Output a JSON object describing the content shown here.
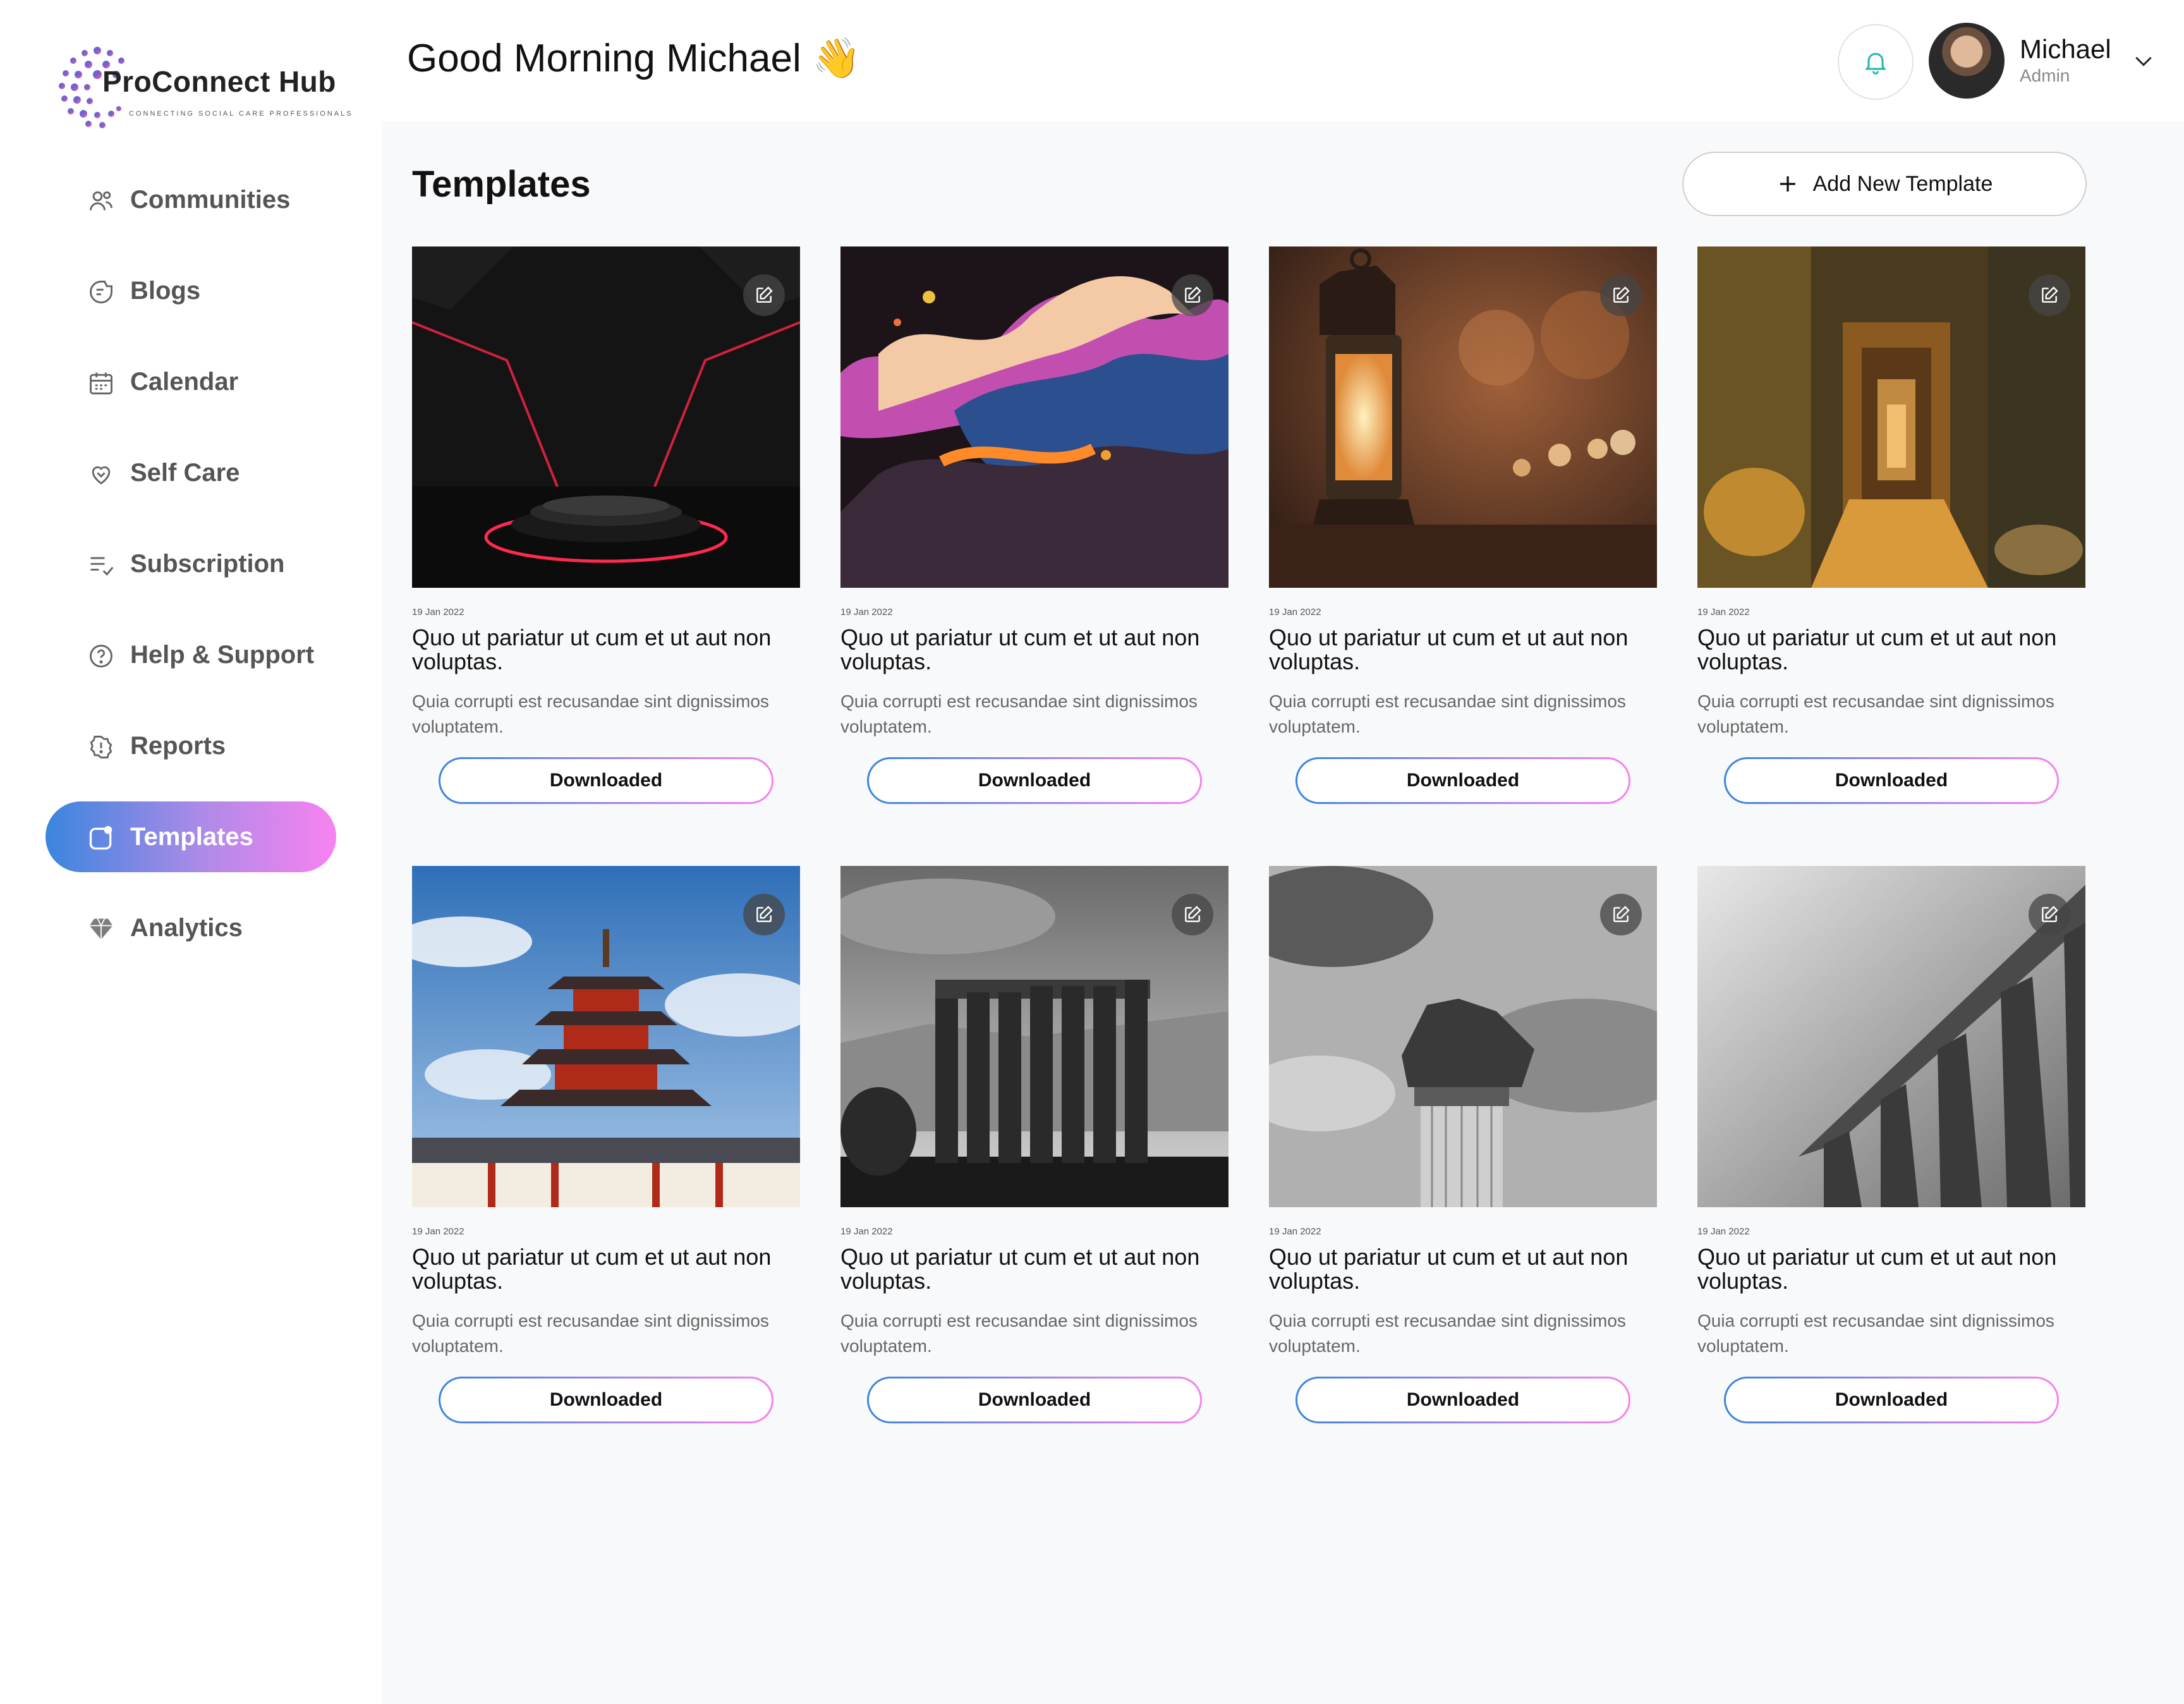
{
  "brand": {
    "name": "ProConnect Hub",
    "tagline": "CONNECTING SOCIAL CARE PROFESSIONALS"
  },
  "sidebar": {
    "items": [
      {
        "label": "Communities",
        "icon": "users-icon"
      },
      {
        "label": "Blogs",
        "icon": "blog-icon"
      },
      {
        "label": "Calendar",
        "icon": "calendar-icon"
      },
      {
        "label": "Self Care",
        "icon": "heart-icon"
      },
      {
        "label": "Subscription",
        "icon": "list-check-icon"
      },
      {
        "label": "Help & Support",
        "icon": "help-icon"
      },
      {
        "label": "Reports",
        "icon": "alert-icon"
      },
      {
        "label": "Templates",
        "icon": "template-icon",
        "active": true
      },
      {
        "label": "Analytics",
        "icon": "diamond-icon"
      }
    ]
  },
  "header": {
    "greeting": "Good Morning Michael",
    "wave_emoji": "👋",
    "user": {
      "name": "Michael",
      "role": "Admin"
    }
  },
  "main": {
    "title": "Templates",
    "add_button": "Add New Template",
    "cards": [
      {
        "date": "19 Jan 2022",
        "title": "Quo ut pariatur ut cum et ut aut non voluptas.",
        "desc": "Quia corrupti est recusandae sint dignissimos voluptatem.",
        "button": "Downloaded",
        "image": "stage-podium"
      },
      {
        "date": "19 Jan 2022",
        "title": "Quo ut pariatur ut cum et ut aut non voluptas.",
        "desc": "Quia corrupti est recusandae sint dignissimos voluptatem.",
        "button": "Downloaded",
        "image": "paint-splash"
      },
      {
        "date": "19 Jan 2022",
        "title": "Quo ut pariatur ut cum et ut aut non voluptas.",
        "desc": "Quia corrupti est recusandae sint dignissimos voluptatem.",
        "button": "Downloaded",
        "image": "lantern"
      },
      {
        "date": "19 Jan 2022",
        "title": "Quo ut pariatur ut cum et ut aut non voluptas.",
        "desc": "Quia corrupti est recusandae sint dignissimos voluptatem.",
        "button": "Downloaded",
        "image": "temple-corridor"
      },
      {
        "date": "19 Jan 2022",
        "title": "Quo ut pariatur ut cum et ut aut non voluptas.",
        "desc": "Quia corrupti est recusandae sint dignissimos voluptatem.",
        "button": "Downloaded",
        "image": "pagoda"
      },
      {
        "date": "19 Jan 2022",
        "title": "Quo ut pariatur ut cum et ut aut non voluptas.",
        "desc": "Quia corrupti est recusandae sint dignissimos voluptatem.",
        "button": "Downloaded",
        "image": "greek-columns"
      },
      {
        "date": "19 Jan 2022",
        "title": "Quo ut pariatur ut cum et ut aut non voluptas.",
        "desc": "Quia corrupti est recusandae sint dignissimos voluptatem.",
        "button": "Downloaded",
        "image": "column-capital"
      },
      {
        "date": "19 Jan 2022",
        "title": "Quo ut pariatur ut cum et ut aut non voluptas.",
        "desc": "Quia corrupti est recusandae sint dignissimos voluptatem.",
        "button": "Downloaded",
        "image": "columns-perspective"
      }
    ]
  },
  "colors": {
    "accent_start": "#3a86de",
    "accent_end": "#f882f0",
    "bell": "#1fb7a8"
  }
}
